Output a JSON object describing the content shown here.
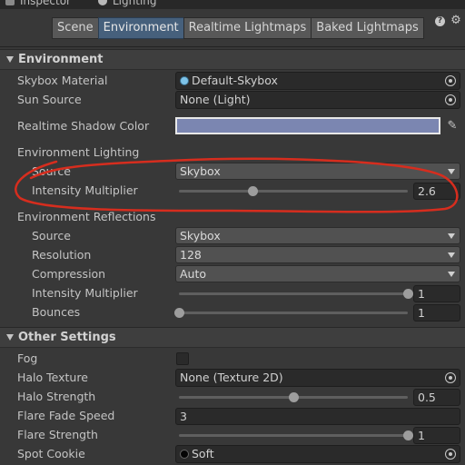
{
  "window_tabs": [
    {
      "label": "Inspector",
      "icon": "info-icon"
    },
    {
      "label": "Lighting",
      "icon": "lightbulb-icon"
    }
  ],
  "tabs": [
    {
      "label": "Scene",
      "active": false
    },
    {
      "label": "Environment",
      "active": true
    },
    {
      "label": "Realtime Lightmaps",
      "active": false
    },
    {
      "label": "Baked Lightmaps",
      "active": false
    }
  ],
  "environment": {
    "title": "Environment",
    "skybox_material": {
      "label": "Skybox Material",
      "value": "Default-Skybox"
    },
    "sun_source": {
      "label": "Sun Source",
      "value": "None (Light)"
    },
    "shadow_color": {
      "label": "Realtime Shadow Color",
      "color": "#7b86b1"
    },
    "lighting": {
      "title": "Environment Lighting",
      "source": {
        "label": "Source",
        "value": "Skybox"
      },
      "intensity": {
        "label": "Intensity Multiplier",
        "value": "2.6",
        "level": 0.325
      }
    },
    "reflections": {
      "title": "Environment Reflections",
      "source": {
        "label": "Source",
        "value": "Skybox"
      },
      "resolution": {
        "label": "Resolution",
        "value": "128"
      },
      "compression": {
        "label": "Compression",
        "value": "Auto"
      },
      "intensity": {
        "label": "Intensity Multiplier",
        "value": "1",
        "level": 1.0
      },
      "bounces": {
        "label": "Bounces",
        "value": "1",
        "level": 0.0
      }
    }
  },
  "other": {
    "title": "Other Settings",
    "fog": {
      "label": "Fog",
      "checked": false
    },
    "halo_texture": {
      "label": "Halo Texture",
      "value": "None (Texture 2D)"
    },
    "halo_strength": {
      "label": "Halo Strength",
      "value": "0.5",
      "level": 0.5
    },
    "flare_fade_speed": {
      "label": "Flare Fade Speed",
      "value": "3"
    },
    "flare_strength": {
      "label": "Flare Strength",
      "value": "1",
      "level": 1.0
    },
    "spot_cookie": {
      "label": "Spot Cookie",
      "value": "Soft"
    }
  },
  "colors": {
    "background": "#383838",
    "active_tab": "#46607c",
    "annotation_stroke": "#d62d1e"
  }
}
